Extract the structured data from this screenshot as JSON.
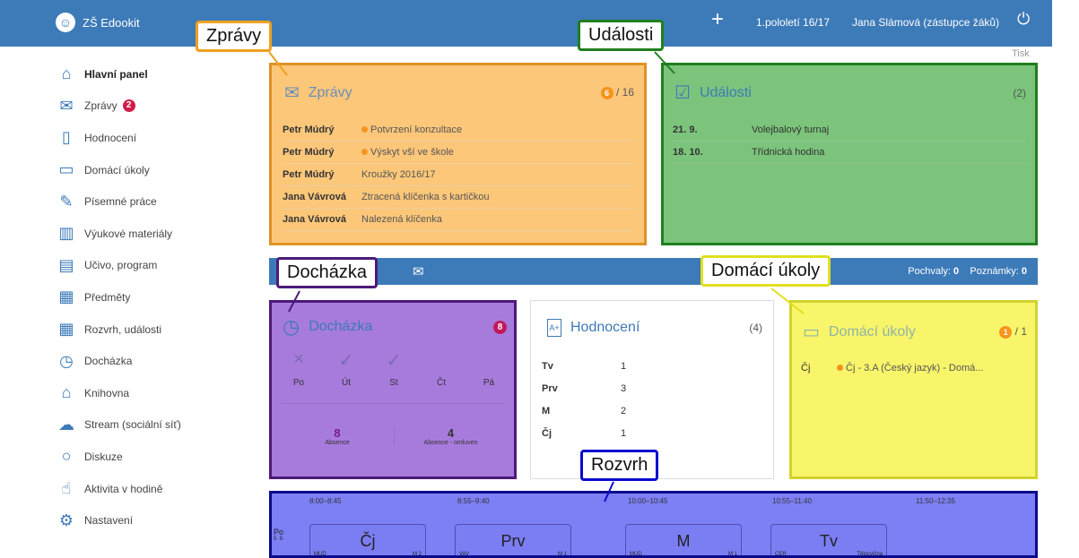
{
  "topbar": {
    "brand": "ZŠ Edookit",
    "plus": "+",
    "term": "1.pololetí 16/17",
    "user": "Jana Slámová (zástupce žáků)",
    "power": "⏻"
  },
  "print": "Tisk",
  "sidebar": {
    "items": [
      {
        "label": "Hlavní panel",
        "icon": "home-icon",
        "glyph": "⌂"
      },
      {
        "label": "Zprávy",
        "icon": "envelope-icon",
        "glyph": "✉",
        "badge": "2"
      },
      {
        "label": "Hodnocení",
        "icon": "grade-document-icon",
        "glyph": "▯"
      },
      {
        "label": "Domácí úkoly",
        "icon": "briefcase-icon",
        "glyph": "▭"
      },
      {
        "label": "Písemné práce",
        "icon": "pen-icon",
        "glyph": "✎"
      },
      {
        "label": "Výukové materiály",
        "icon": "book-icon",
        "glyph": "▥"
      },
      {
        "label": "Učivo, program",
        "icon": "open-book-icon",
        "glyph": "▤"
      },
      {
        "label": "Předměty",
        "icon": "subjects-icon",
        "glyph": "▦"
      },
      {
        "label": "Rozvrh, události",
        "icon": "calendar-icon",
        "glyph": "▦"
      },
      {
        "label": "Docházka",
        "icon": "clock-icon",
        "glyph": "◷"
      },
      {
        "label": "Knihovna",
        "icon": "library-icon",
        "glyph": "⌂"
      },
      {
        "label": "Stream (sociální síť)",
        "icon": "cloud-icon",
        "glyph": "☁"
      },
      {
        "label": "Diskuze",
        "icon": "chat-bubble-icon",
        "glyph": "○"
      },
      {
        "label": "Aktivita v hodině",
        "icon": "hand-icon",
        "glyph": "☝"
      },
      {
        "label": "Nastavení",
        "icon": "gear-icon",
        "glyph": "⚙"
      }
    ]
  },
  "messages": {
    "title": "Zprávy",
    "unread": "6",
    "total": "/ 16",
    "rows": [
      {
        "from": "Petr Múdrý",
        "subject": "Potvrzení konzultace",
        "unread": true
      },
      {
        "from": "Petr Múdrý",
        "subject": "Výskyt vší ve škole",
        "unread": true
      },
      {
        "from": "Petr Múdrý",
        "subject": "Kroužky 2016/17",
        "unread": false
      },
      {
        "from": "Jana Vávrová",
        "subject": "Ztracená klíčenka s kartičkou",
        "unread": false
      },
      {
        "from": "Jana Vávrová",
        "subject": "Nalezená klíčenka",
        "unread": false
      }
    ]
  },
  "events": {
    "title": "Události",
    "count": "(2)",
    "rows": [
      {
        "date": "21. 9.",
        "name": "Volejbalový turnaj"
      },
      {
        "date": "18. 10.",
        "name": "Třídnická hodina"
      }
    ]
  },
  "midbar": {
    "praise": "Pochvaly:",
    "praise_val": "0",
    "notes": "Poznámky:",
    "notes_val": "0"
  },
  "attendance": {
    "title": "Docházka",
    "badge": "8",
    "days": [
      {
        "mark": "×",
        "day": "Po"
      },
      {
        "mark": "✓",
        "day": "Út"
      },
      {
        "mark": "✓",
        "day": "St"
      },
      {
        "mark": "",
        "day": "Čt"
      },
      {
        "mark": "",
        "day": "Pá"
      }
    ],
    "absence": "8",
    "absence_label": "Absence",
    "excused": "4",
    "excused_label": "Absence - omluven"
  },
  "grades": {
    "title": "Hodnocení",
    "count": "(4)",
    "rows": [
      {
        "s": "Tv",
        "v": "1"
      },
      {
        "s": "Prv",
        "v": "3"
      },
      {
        "s": "M",
        "v": "2"
      },
      {
        "s": "Čj",
        "v": "1"
      }
    ]
  },
  "homework": {
    "title": "Domácí úkoly",
    "badge": "1",
    "total": "/ 1",
    "rows": [
      {
        "s": "Čj",
        "t": "Čj - 3.A (Český jazyk) - Domá..."
      }
    ]
  },
  "schedule": {
    "day": "Po",
    "day_sub": "5. 9.",
    "times": [
      "8:00–8:45",
      "8:55–9:40",
      "10:00–10:45",
      "10:55–11:40",
      "11:50–12:35"
    ],
    "lessons": [
      {
        "subj": "Čj",
        "t": "MUD",
        "r": "M 2"
      },
      {
        "subj": "Prv",
        "t": "VAV",
        "r": "M 1"
      },
      {
        "subj": "M",
        "t": "MUD",
        "r": "M 1"
      },
      {
        "subj": "Tv",
        "t": "CER",
        "r": "Tělocvična"
      }
    ]
  },
  "callouts": {
    "zpravy": "Zprávy",
    "udalosti": "Události",
    "dochazka": "Docházka",
    "ukoly": "Domácí úkoly",
    "rozvrh": "Rozvrh"
  },
  "colors": {
    "brand": "#3d7ab8",
    "orange": "#fdc77a",
    "green": "#7cc47c",
    "purple": "#a77bdc",
    "yellow": "#f8f56a",
    "blue": "#7d7ff5"
  }
}
